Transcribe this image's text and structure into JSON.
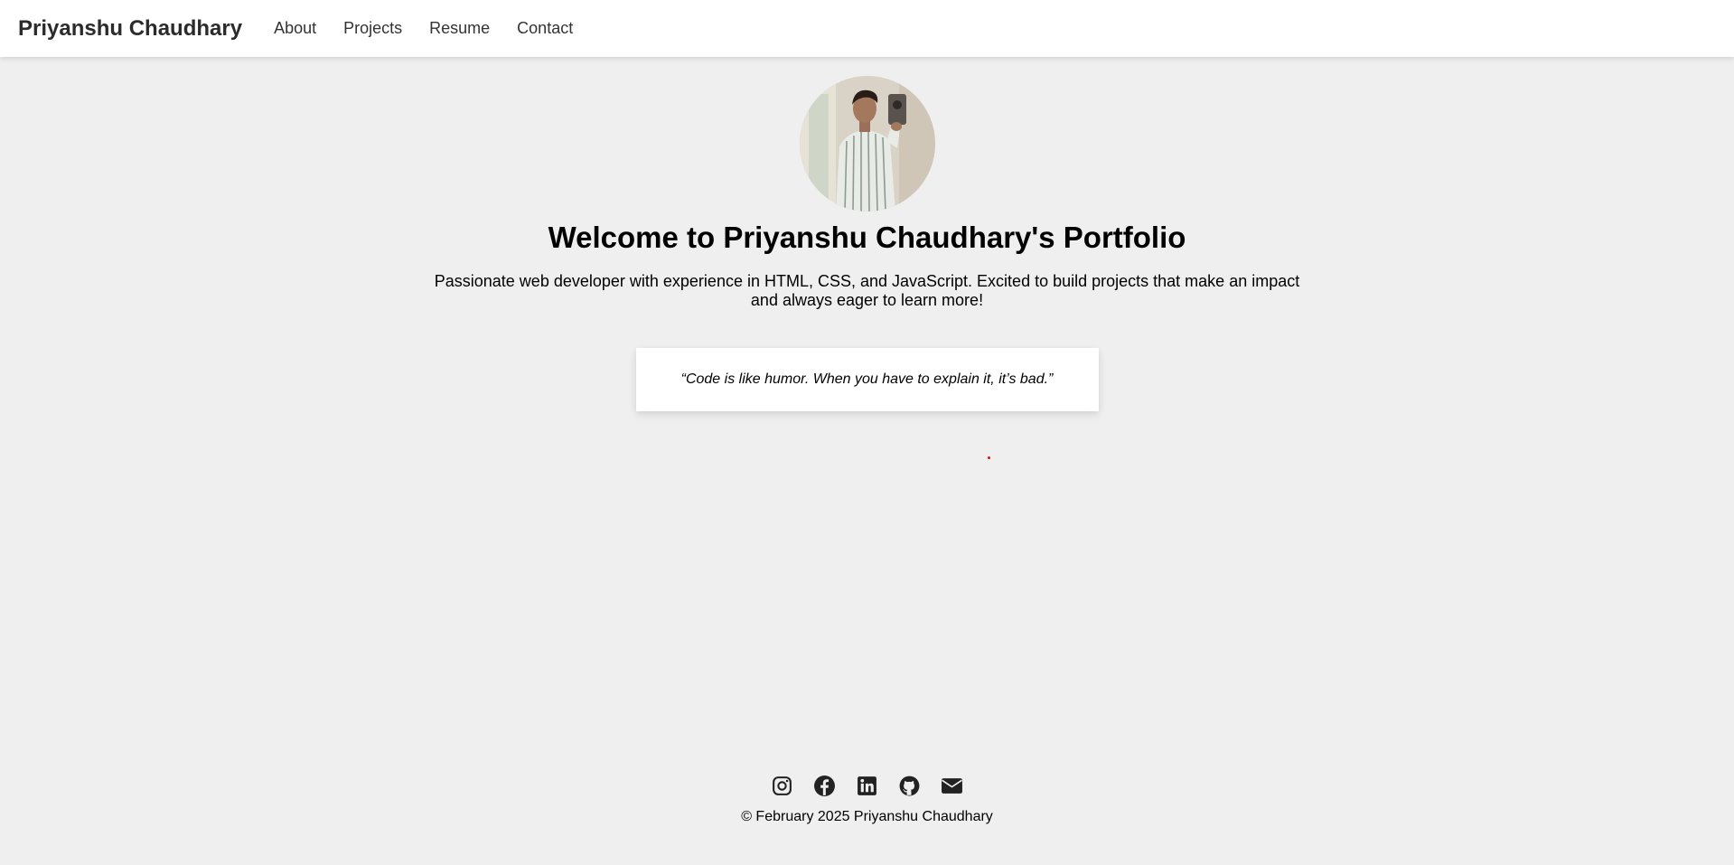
{
  "nav": {
    "brand": "Priyanshu Chaudhary",
    "links": [
      "About",
      "Projects",
      "Resume",
      "Contact"
    ]
  },
  "hero": {
    "title": "Welcome to Priyanshu Chaudhary's Portfolio",
    "bio": "Passionate web developer with experience in HTML, CSS, and JavaScript. Excited to build projects that make an impact and always eager to learn more!",
    "quote": "“Code is like humor. When you have to explain it, it’s bad.”"
  },
  "footer": {
    "social_icons": [
      "instagram-icon",
      "facebook-icon",
      "linkedin-icon",
      "github-icon",
      "email-icon"
    ],
    "copyright": "© February 2025 Priyanshu Chaudhary"
  },
  "colors": {
    "background": "#efefef",
    "navbar": "#ffffff",
    "text": "#000000",
    "icon": "#222222"
  }
}
